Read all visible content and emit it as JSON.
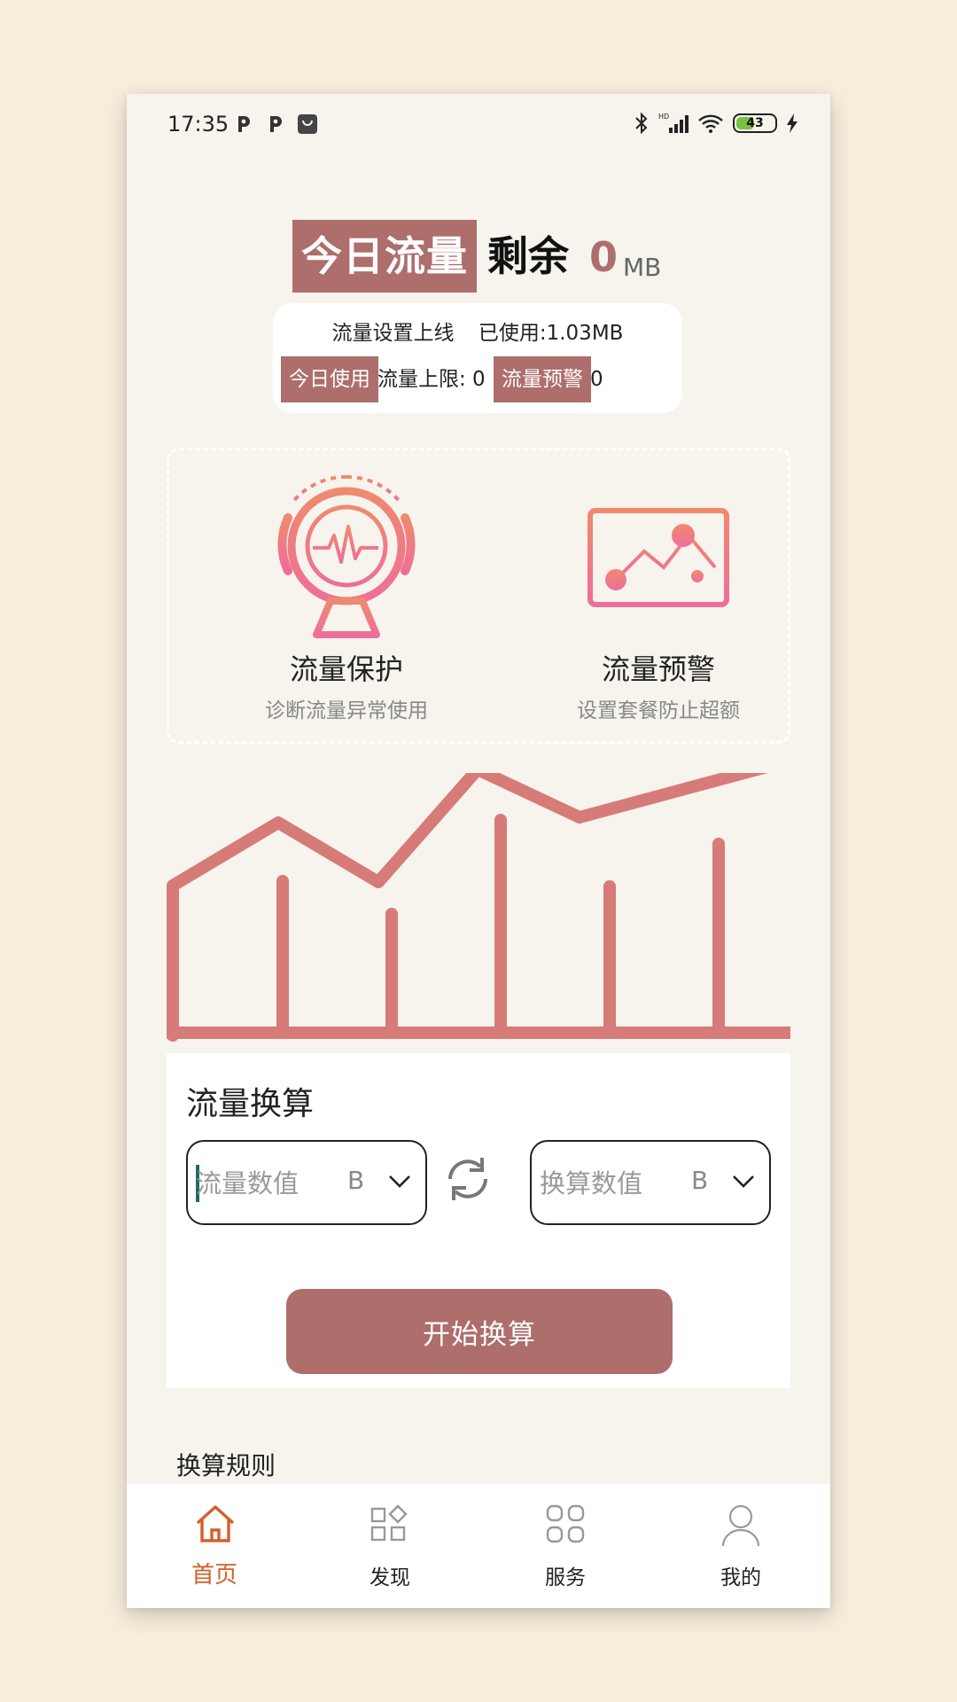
{
  "status_bar": {
    "time": "17:35",
    "battery": "43",
    "icons": [
      "p-app-icon",
      "p-app-icon",
      "store-icon",
      "bluetooth-icon",
      "hd-signal-icon",
      "wifi-icon",
      "battery-icon",
      "charging-icon"
    ]
  },
  "header": {
    "today_label": "今日流量",
    "remaining_label": "剩余",
    "remaining_value": "0",
    "remaining_unit": "MB"
  },
  "usage": {
    "setting_text": "流量设置上线",
    "used_text": "已使用:1.03MB",
    "today_use_label": "今日使用",
    "limit_text": "流量上限: 0",
    "warning_label": "流量预警",
    "warning_value": "0"
  },
  "features": [
    {
      "title": "流量保护",
      "subtitle": "诊断流量异常使用",
      "icon": "heartbeat-monitor-icon"
    },
    {
      "title": "流量预警",
      "subtitle": "设置套餐防止超额",
      "icon": "trend-monitor-icon"
    }
  ],
  "colors": {
    "accent": "#ad6e6c",
    "chart": "#d67b78",
    "nav_active": "#d1612b",
    "background": "#f7f3ed"
  },
  "conversion": {
    "title": "流量换算",
    "input_placeholder": "流量数值",
    "input_unit": "B",
    "output_placeholder": "换算数值",
    "output_unit": "B",
    "button_label": "开始换算"
  },
  "rules": {
    "title": "换算规则"
  },
  "nav": {
    "items": [
      {
        "label": "首页",
        "icon": "home-icon",
        "active": true
      },
      {
        "label": "发现",
        "icon": "discover-icon",
        "active": false
      },
      {
        "label": "服务",
        "icon": "service-grid-icon",
        "active": false
      },
      {
        "label": "我的",
        "icon": "profile-icon",
        "active": false
      }
    ]
  }
}
